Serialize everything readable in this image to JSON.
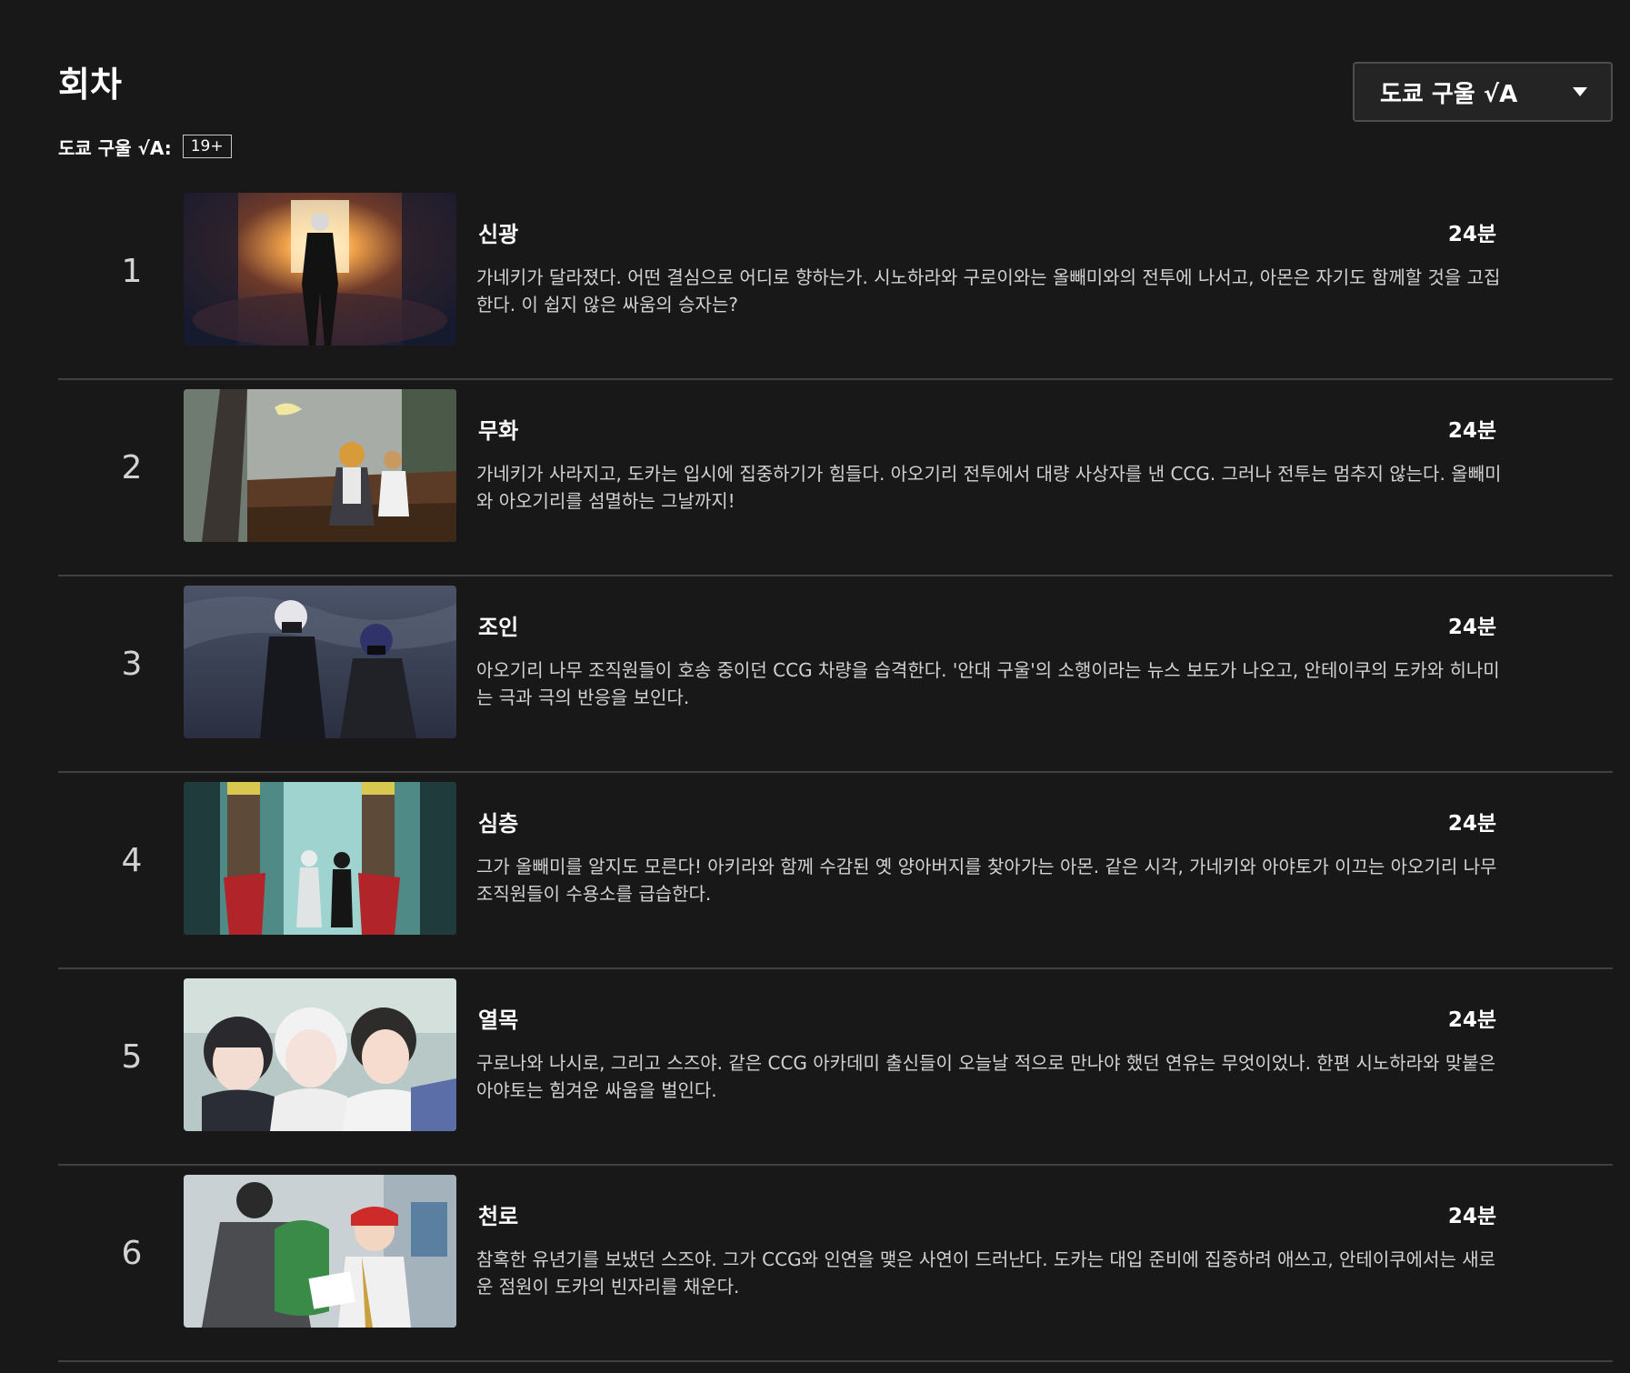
{
  "header": {
    "title": "회차",
    "season_selector": "도쿄 구울 √A"
  },
  "subheader": {
    "show_label": "도쿄 구울 √A:",
    "rating": "19+"
  },
  "episodes": [
    {
      "number": "1",
      "title": "신광",
      "duration": "24분",
      "description": "가네키가 달라졌다. 어떤 결심으로 어디로 향하는가. 시노하라와 구로이와는 올빼미와의 전투에 나서고, 아몬은 자기도 함께할 것을 고집한다. 이 쉽지 않은 싸움의 승자는?"
    },
    {
      "number": "2",
      "title": "무화",
      "duration": "24분",
      "description": "가네키가 사라지고, 도카는 입시에 집중하기가 힘들다. 아오기리 전투에서 대량 사상자를 낸 CCG. 그러나 전투는 멈추지 않는다. 올빼미와 아오기리를 섬멸하는 그날까지!"
    },
    {
      "number": "3",
      "title": "조인",
      "duration": "24분",
      "description": "아오기리 나무 조직원들이 호송 중이던 CCG 차량을 습격한다. '안대 구울'의 소행이라는 뉴스 보도가 나오고, 안테이쿠의 도카와 히나미는 극과 극의 반응을 보인다."
    },
    {
      "number": "4",
      "title": "심층",
      "duration": "24분",
      "description": "그가 올빼미를 알지도 모른다! 아키라와 함께 수감된 옛 양아버지를 찾아가는 아몬. 같은 시각, 가네키와 아야토가 이끄는 아오기리 나무 조직원들이 수용소를 급습한다."
    },
    {
      "number": "5",
      "title": "열목",
      "duration": "24분",
      "description": "구로나와 나시로, 그리고 스즈야. 같은 CCG 아카데미 출신들이 오늘날 적으로 만나야 했던 연유는 무엇이었나. 한편 시노하라와 맞붙은 아야토는 힘겨운 싸움을 벌인다."
    },
    {
      "number": "6",
      "title": "천로",
      "duration": "24분",
      "description": "참혹한 유년기를 보냈던 스즈야. 그가 CCG와 인연을 맺은 사연이 드러난다. 도카는 대입 준비에 집중하려 애쓰고, 안테이쿠에서는 새로운 점원이 도카의 빈자리를 채운다."
    }
  ],
  "colors": {
    "background": "#181818",
    "divider": "#404040",
    "text_primary": "#ffffff",
    "text_secondary": "#d2d2d2"
  }
}
